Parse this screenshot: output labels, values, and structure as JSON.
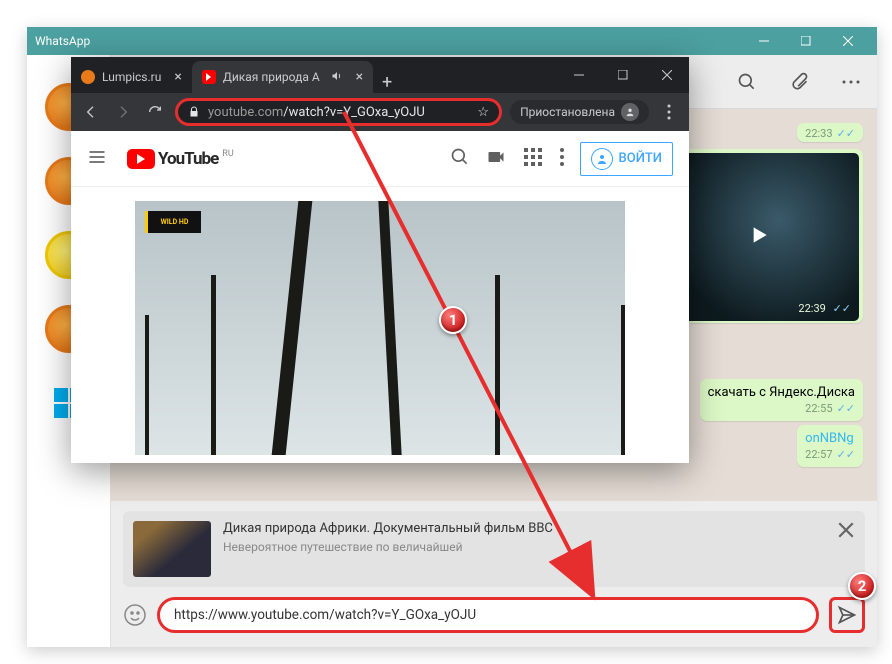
{
  "whatsapp": {
    "title": "WhatsApp",
    "messages": {
      "video": {
        "time": "22:33",
        "duration": "22:39"
      },
      "txt1": {
        "text": "скачать с Яндекс.Диска",
        "time": "22:55"
      },
      "txt2": {
        "text": "onNBNg",
        "time": "22:57"
      }
    },
    "compose": {
      "preview": {
        "title": "Дикая природа Африки. Документальный фильм BBC",
        "desc": "Невероятное путешествие по величайшей"
      },
      "input_value": "https://www.youtube.com/watch?v=Y_GOxa_yOJU"
    }
  },
  "chrome": {
    "tabs": {
      "tab1": "Lumpics.ru",
      "tab2": "Дикая природа А"
    },
    "url_host": "youtube.com",
    "url_path": "/watch?v=Y_GOxa_yOJU",
    "paused": "Приостановлена"
  },
  "youtube": {
    "brand": "YouTube",
    "region": "RU",
    "login": "ВОЙТИ",
    "badge": "WILD HD"
  },
  "callouts": {
    "c1": "1",
    "c2": "2"
  }
}
